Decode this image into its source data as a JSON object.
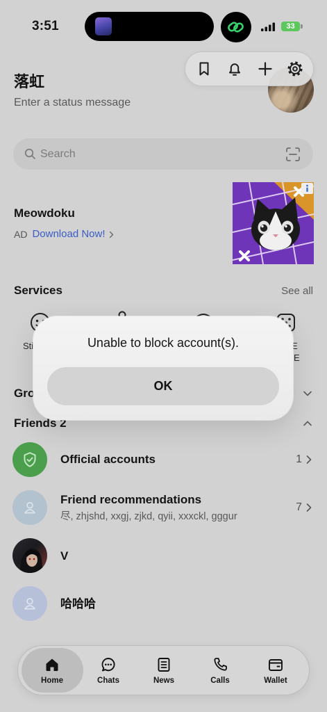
{
  "status_bar": {
    "time": "3:51",
    "battery_level": "33",
    "icons": [
      "linked-rings-icon",
      "cellular-signal-icon",
      "battery-icon"
    ]
  },
  "toolbar": {
    "icons": [
      "bookmark-icon",
      "bell-icon",
      "plus-icon",
      "gear-icon"
    ]
  },
  "profile": {
    "name": "落虹",
    "status_message_placeholder": "Enter a status message"
  },
  "search": {
    "placeholder": "Search",
    "icons": [
      "search-icon",
      "scan-icon"
    ]
  },
  "ad": {
    "title": "Meowdoku",
    "badge": "AD",
    "cta": "Download Now!",
    "icons": [
      "info-icon",
      "chevron-right-icon"
    ]
  },
  "services": {
    "heading": "Services",
    "see_all": "See all",
    "items": [
      {
        "icon": "smiley-icon",
        "label": "Sti"
      },
      {
        "icon": "service-icon"
      },
      {
        "icon": "service-icon"
      },
      {
        "icon": "dice-icon",
        "label_lines": [
          "E",
          "E"
        ]
      }
    ]
  },
  "groups": {
    "heading": "Gro",
    "icon": "chevron-down-icon"
  },
  "friends": {
    "heading": "Friends 2",
    "icon": "chevron-up-icon",
    "rows": [
      {
        "name": "Official accounts",
        "count": "1",
        "avatar_icon": "shield-check-icon"
      },
      {
        "name": "Friend recommendations",
        "subtitle": "尽, zhjshd, xxgj, zjkd, qyii, xxxckl, gggur",
        "count": "7",
        "avatar_icon": "person-icon"
      },
      {
        "name": "V"
      },
      {
        "name": "哈哈哈",
        "avatar_icon": "person-icon"
      }
    ]
  },
  "dialog": {
    "message": "Unable to block account(s).",
    "ok_label": "OK"
  },
  "tab_bar": {
    "tabs": [
      {
        "label": "Home",
        "icon": "home-icon",
        "selected": true
      },
      {
        "label": "Chats",
        "icon": "chat-bubble-icon",
        "selected": false
      },
      {
        "label": "News",
        "icon": "news-icon",
        "selected": false
      },
      {
        "label": "Calls",
        "icon": "phone-icon",
        "selected": false
      },
      {
        "label": "Wallet",
        "icon": "wallet-icon",
        "selected": false
      }
    ]
  },
  "colors": {
    "background": "#d2d2d2",
    "official_green": "#4b9f4c",
    "link_blue": "#3a5cc4",
    "battery_green": "#5cc75c"
  }
}
